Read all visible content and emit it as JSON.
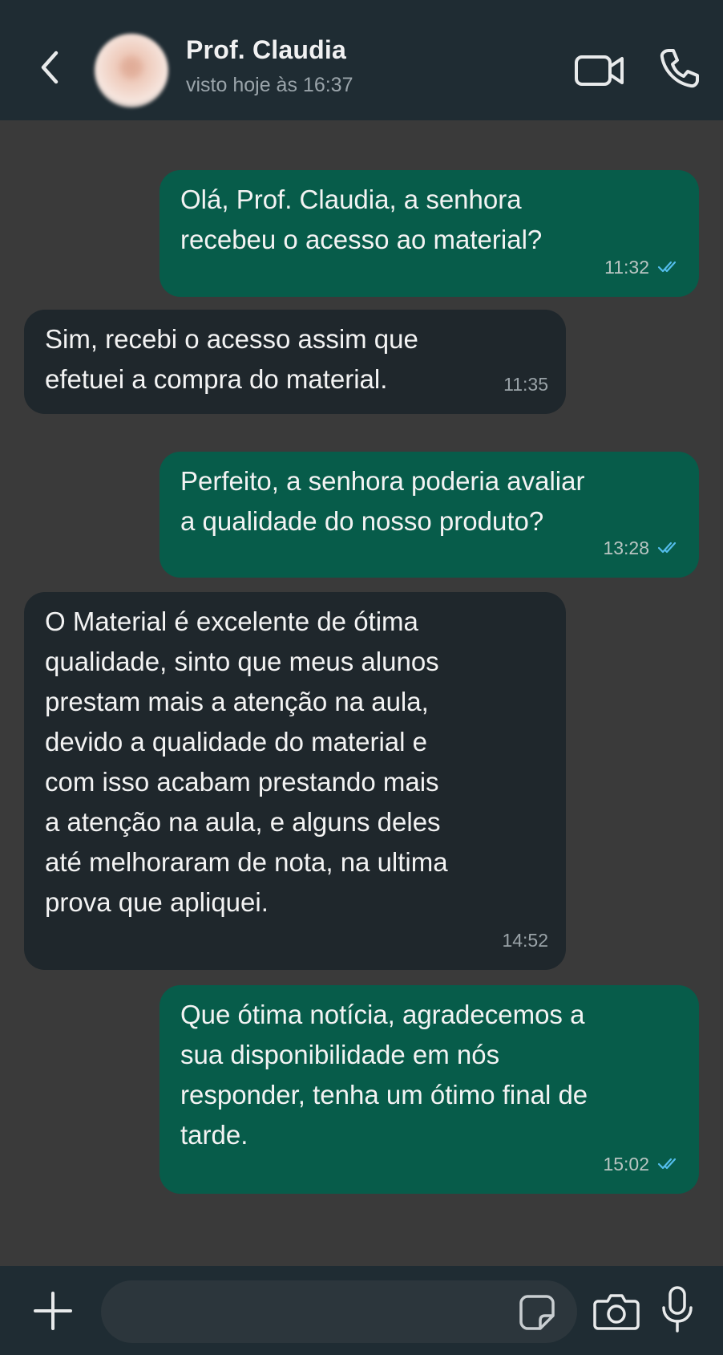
{
  "header": {
    "contact_name": "Prof. Claudia",
    "status": "visto hoje às 16:37",
    "back_icon": "chevron-left-icon",
    "video_icon": "video-camera-icon",
    "call_icon": "phone-icon"
  },
  "messages": [
    {
      "direction": "out",
      "text": "Olá, Prof. Claudia, a senhora\nrecebeu o acesso ao material?",
      "time": "11:32",
      "status": "read"
    },
    {
      "direction": "in",
      "text": "Sim, recebi o acesso assim que\nefetuei a compra do material.",
      "time": "11:35"
    },
    {
      "direction": "out",
      "text": "Perfeito, a senhora poderia avaliar\na qualidade do nosso produto?",
      "time": "13:28",
      "status": "read"
    },
    {
      "direction": "in",
      "text": "O Material é excelente de ótima\nqualidade, sinto que meus alunos\nprestam mais a atenção na aula,\ndevido a qualidade do material e\ncom isso acabam prestando mais\na atenção na aula, e alguns deles\naté melhoraram de nota, na ultima\nprova que apliquei.",
      "time": "14:52"
    },
    {
      "direction": "out",
      "text": "Que ótima notícia, agradecemos a\nsua disponibilidade em nós\nresponder, tenha um ótimo final de\ntarde.",
      "time": "15:02",
      "status": "read"
    }
  ],
  "footer": {
    "input_value": "",
    "plus_icon": "plus-icon",
    "sticker_icon": "sticker-icon",
    "camera_icon": "camera-icon",
    "mic_icon": "microphone-icon"
  },
  "colors": {
    "header_bg": "#1f2c33",
    "chat_bg": "#3a3a3a",
    "outgoing_bubble": "#075c4a",
    "incoming_bubble": "#1f272c",
    "read_tick": "#53bdeb"
  }
}
